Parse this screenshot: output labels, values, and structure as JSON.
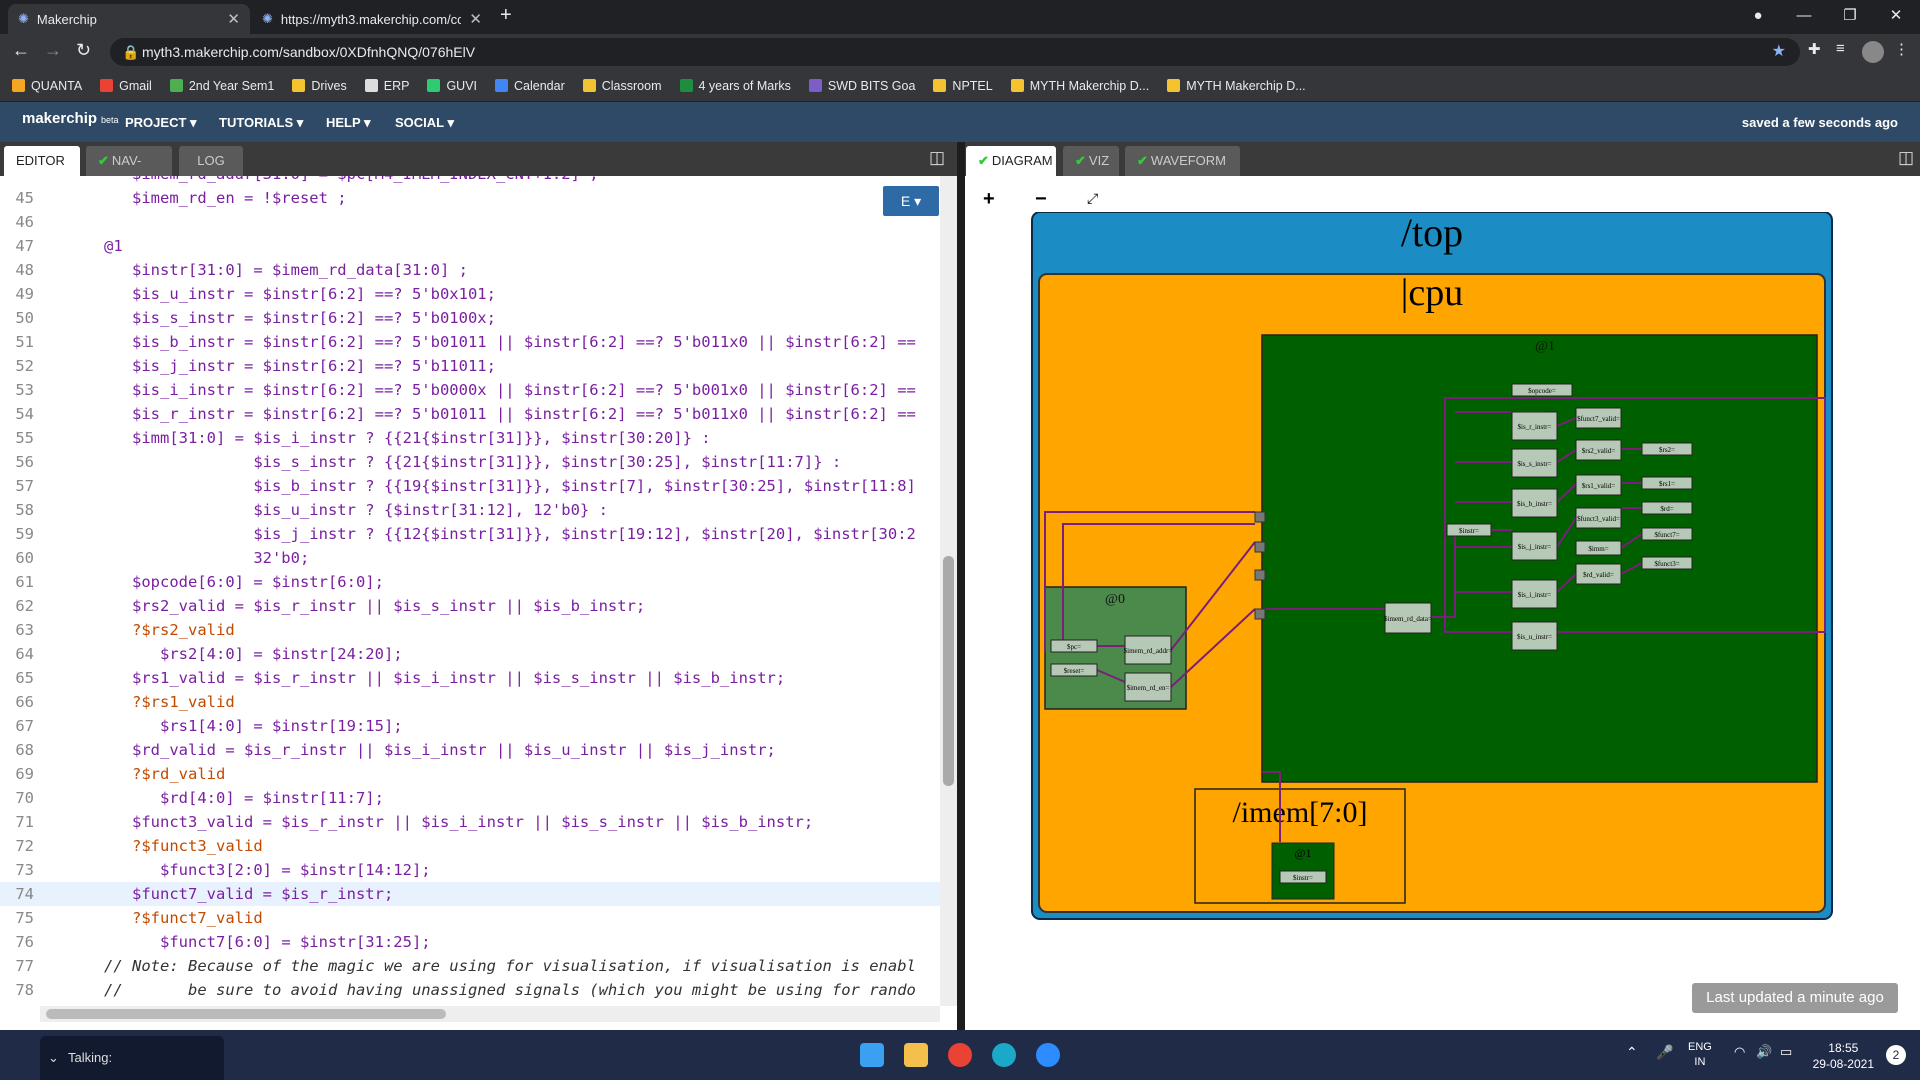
{
  "browser": {
    "tabs": [
      {
        "title": "Makerchip"
      },
      {
        "title": "https://myth3.makerchip.com/cc"
      }
    ],
    "url": "myth3.makerchip.com/sandbox/0XDfnhQNQ/076hElV",
    "bookmarks": [
      "QUANTA",
      "Gmail",
      "2nd Year Sem1",
      "Drives",
      "ERP",
      "GUVI",
      "Calendar",
      "Classroom",
      "4 years of Marks",
      "SWD BITS Goa",
      "NPTEL",
      "MYTH Makerchip D...",
      "MYTH Makerchip D..."
    ],
    "bookmark_colors": [
      "#f5a623",
      "#ea4335",
      "#4caf50",
      "#f4c430",
      "#ddd",
      "#2ecc71",
      "#4285f4",
      "#f4c430",
      "#1e8e3e",
      "#7b5fc7",
      "#f4c430",
      "#f4c430",
      "#f4c430"
    ]
  },
  "header": {
    "logo": "makerchip",
    "beta": "beta",
    "menus": [
      "PROJECT ▾",
      "TUTORIALS ▾",
      "HELP ▾",
      "SOCIAL ▾"
    ],
    "status": "saved a few seconds ago"
  },
  "left_tabs": [
    "EDITOR",
    "NAV-TLV",
    "LOG"
  ],
  "right_tabs": [
    "DIAGRAM",
    "VIZ",
    "WAVEFORM"
  ],
  "editor_button": "E ▾",
  "code_lines": [
    {
      "n": "45",
      "t": "$imem_rd_en = !$reset ;",
      "i": 1,
      "k": "n"
    },
    {
      "n": "46",
      "t": "",
      "i": 0,
      "k": "n"
    },
    {
      "n": "47",
      "t": "@1",
      "i": 0,
      "k": "s"
    },
    {
      "n": "48",
      "t": "$instr[31:0] = $imem_rd_data[31:0] ;",
      "i": 1,
      "k": "n"
    },
    {
      "n": "49",
      "t": "$is_u_instr = $instr[6:2] ==? 5'b0x101;",
      "i": 1,
      "k": "n"
    },
    {
      "n": "50",
      "t": "$is_s_instr = $instr[6:2] ==? 5'b0100x;",
      "i": 1,
      "k": "n"
    },
    {
      "n": "51",
      "t": "$is_b_instr = $instr[6:2] ==? 5'b01011 || $instr[6:2] ==? 5'b011x0 || $instr[6:2] ==",
      "i": 1,
      "k": "n"
    },
    {
      "n": "52",
      "t": "$is_j_instr = $instr[6:2] ==? 5'b11011;",
      "i": 1,
      "k": "n"
    },
    {
      "n": "53",
      "t": "$is_i_instr = $instr[6:2] ==? 5'b0000x || $instr[6:2] ==? 5'b001x0 || $instr[6:2] ==",
      "i": 1,
      "k": "n"
    },
    {
      "n": "54",
      "t": "$is_r_instr = $instr[6:2] ==? 5'b01011 || $instr[6:2] ==? 5'b011x0 || $instr[6:2] ==",
      "i": 1,
      "k": "n"
    },
    {
      "n": "55",
      "t": "$imm[31:0] = $is_i_instr ? {{21{$instr[31]}}, $instr[30:20]} :",
      "i": 1,
      "k": "n"
    },
    {
      "n": "56",
      "t": "             $is_s_instr ? {{21{$instr[31]}}, $instr[30:25], $instr[11:7]} :",
      "i": 1,
      "k": "n"
    },
    {
      "n": "57",
      "t": "             $is_b_instr ? {{19{$instr[31]}}, $instr[7], $instr[30:25], $instr[11:8]",
      "i": 1,
      "k": "n"
    },
    {
      "n": "58",
      "t": "             $is_u_instr ? {$instr[31:12], 12'b0} :",
      "i": 1,
      "k": "n"
    },
    {
      "n": "59",
      "t": "             $is_j_instr ? {{12{$instr[31]}}, $instr[19:12], $instr[20], $instr[30:2",
      "i": 1,
      "k": "n"
    },
    {
      "n": "60",
      "t": "             32'b0;",
      "i": 1,
      "k": "n"
    },
    {
      "n": "61",
      "t": "$opcode[6:0] = $instr[6:0];",
      "i": 1,
      "k": "n"
    },
    {
      "n": "62",
      "t": "$rs2_valid = $is_r_instr || $is_s_instr || $is_b_instr;",
      "i": 1,
      "k": "n"
    },
    {
      "n": "63",
      "t": "?$rs2_valid",
      "i": 1,
      "k": "w"
    },
    {
      "n": "64",
      "t": "$rs2[4:0] = $instr[24:20];",
      "i": 2,
      "k": "n"
    },
    {
      "n": "65",
      "t": "$rs1_valid = $is_r_instr || $is_i_instr || $is_s_instr || $is_b_instr;",
      "i": 1,
      "k": "n"
    },
    {
      "n": "66",
      "t": "?$rs1_valid",
      "i": 1,
      "k": "w"
    },
    {
      "n": "67",
      "t": "$rs1[4:0] = $instr[19:15];",
      "i": 2,
      "k": "n"
    },
    {
      "n": "68",
      "t": "$rd_valid = $is_r_instr || $is_i_instr || $is_u_instr || $is_j_instr;",
      "i": 1,
      "k": "n"
    },
    {
      "n": "69",
      "t": "?$rd_valid",
      "i": 1,
      "k": "w"
    },
    {
      "n": "70",
      "t": "$rd[4:0] = $instr[11:7];",
      "i": 2,
      "k": "n"
    },
    {
      "n": "71",
      "t": "$funct3_valid = $is_r_instr || $is_i_instr || $is_s_instr || $is_b_instr;",
      "i": 1,
      "k": "n"
    },
    {
      "n": "72",
      "t": "?$funct3_valid",
      "i": 1,
      "k": "w"
    },
    {
      "n": "73",
      "t": "$funct3[2:0] = $instr[14:12];",
      "i": 2,
      "k": "n"
    },
    {
      "n": "74",
      "t": "$funct7_valid = $is_r_instr;",
      "i": 1,
      "k": "h"
    },
    {
      "n": "75",
      "t": "?$funct7_valid",
      "i": 1,
      "k": "w"
    },
    {
      "n": "76",
      "t": "$funct7[6:0] = $instr[31:25];",
      "i": 2,
      "k": "n"
    },
    {
      "n": "77",
      "t": "// Note: Because of the magic we are using for visualisation, if visualisation is enabl",
      "i": 0,
      "k": "c"
    },
    {
      "n": "78",
      "t": "//       be sure to avoid having unassigned signals (which you might be using for rando",
      "i": 0,
      "k": "c"
    },
    {
      "n": "79",
      "t": "//       other than those specifically expected in the labs. You'll get strange errors",
      "i": 0,
      "k": "c"
    }
  ],
  "diagram": {
    "top": "/top",
    "cpu": "|cpu",
    "stage1": "@1",
    "stage0": "@0",
    "imem": "/imem[7:0]",
    "imem_stage": "@1",
    "zoom_in": "+",
    "zoom_out": "−",
    "signals_stage0": [
      "$pc=",
      "$reset=",
      "$imem_rd_addr=",
      "$imem_rd_en="
    ],
    "signals_stage1": [
      "$opcode=",
      "$is_r_instr=",
      "$is_s_instr=",
      "$is_b_instr=",
      "$is_j_instr=",
      "$is_i_instr=",
      "$is_u_instr=",
      "$funct7_valid=",
      "$rs2_valid=",
      "$rs1_valid=",
      "$funct3_valid=",
      "$imm=",
      "$rd_valid=",
      "$rs2=",
      "$rs1=",
      "$rd=",
      "$funct7=",
      "$funct3=",
      "$instr=",
      "$imem_rd_data="
    ],
    "imem_signal": "$instr="
  },
  "last_updated": "Last updated a minute ago",
  "taskbar": {
    "talking": "Talking:",
    "lang": [
      "ENG",
      "IN"
    ],
    "time": "18:55",
    "date": "29-08-2021",
    "notif": "2"
  }
}
